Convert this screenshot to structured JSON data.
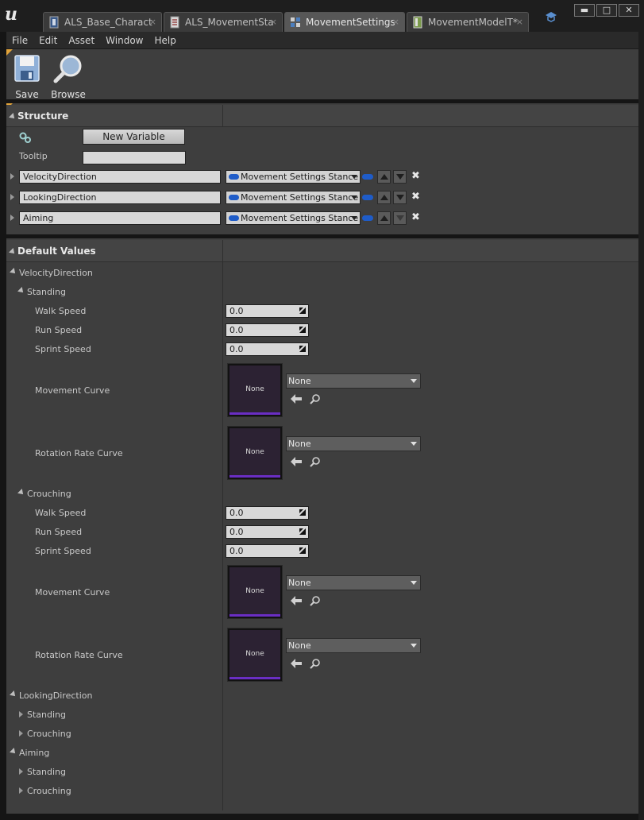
{
  "window": {
    "tabs": [
      {
        "label": "ALS_Base_Charact",
        "close": "×"
      },
      {
        "label": "ALS_MovementSta",
        "close": "×"
      },
      {
        "label": "MovementSettings",
        "close": "×"
      },
      {
        "label": "MovementModelT*",
        "close": "×"
      }
    ],
    "buttons": {
      "minimize": "▬",
      "maximize": "□",
      "close": "✕"
    }
  },
  "menu": [
    "File",
    "Edit",
    "Asset",
    "Window",
    "Help"
  ],
  "toolbar": {
    "save_label": "Save",
    "browse_label": "Browse"
  },
  "structure": {
    "title": "Structure",
    "new_variable_label": "New Variable",
    "tooltip_label": "Tooltip",
    "tooltip_value": "",
    "variables": [
      {
        "name": "VelocityDirection",
        "type": "Movement Settings Stance"
      },
      {
        "name": "LookingDirection",
        "type": "Movement Settings Stance"
      },
      {
        "name": "Aiming",
        "type": "Movement Settings Stance"
      }
    ],
    "remove_glyph": "✖"
  },
  "defaults": {
    "title": "Default Values",
    "velocity_direction": {
      "label": "VelocityDirection",
      "standing": {
        "label": "Standing",
        "walk_speed": {
          "label": "Walk Speed",
          "value": "0.0"
        },
        "run_speed": {
          "label": "Run Speed",
          "value": "0.0"
        },
        "sprint_speed": {
          "label": "Sprint Speed",
          "value": "0.0"
        },
        "movement_curve": {
          "label": "Movement Curve",
          "thumb": "None",
          "value": "None"
        },
        "rotation_rate_curve": {
          "label": "Rotation Rate Curve",
          "thumb": "None",
          "value": "None"
        }
      },
      "crouching": {
        "label": "Crouching",
        "walk_speed": {
          "label": "Walk Speed",
          "value": "0.0"
        },
        "run_speed": {
          "label": "Run Speed",
          "value": "0.0"
        },
        "sprint_speed": {
          "label": "Sprint Speed",
          "value": "0.0"
        },
        "movement_curve": {
          "label": "Movement Curve",
          "thumb": "None",
          "value": "None"
        },
        "rotation_rate_curve": {
          "label": "Rotation Rate Curve",
          "thumb": "None",
          "value": "None"
        }
      }
    },
    "looking_direction": {
      "label": "LookingDirection",
      "standing": "Standing",
      "crouching": "Crouching"
    },
    "aiming": {
      "label": "Aiming",
      "standing": "Standing",
      "crouching": "Crouching"
    }
  }
}
